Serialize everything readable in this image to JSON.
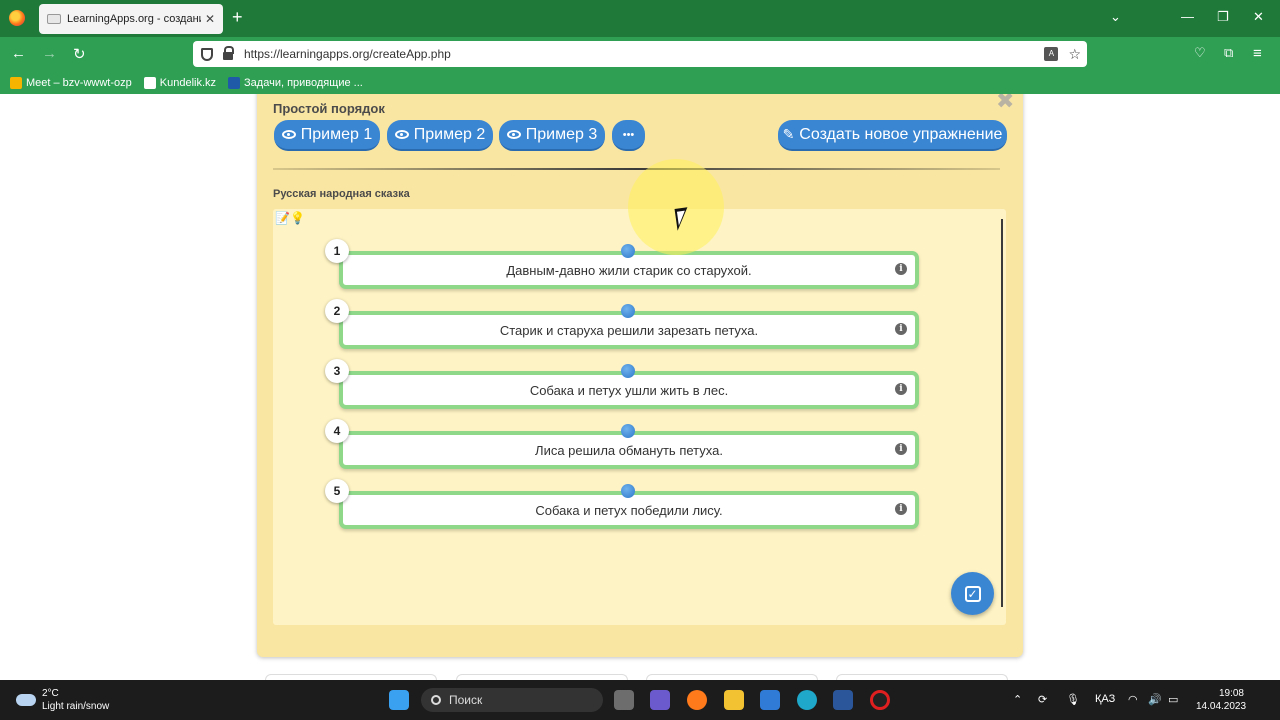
{
  "browser": {
    "tab_title": "LearningApps.org - создание м",
    "url": "https://learningapps.org/createApp.php",
    "bookmarks": [
      {
        "label": "Meet – bzv-wwwt-ozp"
      },
      {
        "label": "Kundelik.kz"
      },
      {
        "label": "Задачи, приводящие ..."
      }
    ]
  },
  "panel": {
    "title": "Простой порядок",
    "buttons": {
      "example1": "Пример 1",
      "example2": "Пример 2",
      "example3": "Пример 3",
      "more": "•••",
      "create": "Создать новое упражнение"
    },
    "story_title": "Русская народная сказка",
    "items": [
      {
        "number": "1",
        "text": "Давным-давно жили старик со старухой."
      },
      {
        "number": "2",
        "text": "Старик и старуха решили зарезать петуха."
      },
      {
        "number": "3",
        "text": "Собака и петух ушли жить в лес."
      },
      {
        "number": "4",
        "text": "Лиса решила обмануть петуха."
      },
      {
        "number": "5",
        "text": "Собака и петух победили лису."
      }
    ]
  },
  "taskbar": {
    "temperature": "2°C",
    "weather": "Light rain/snow",
    "search_placeholder": "Поиск",
    "language": "ҚАЗ",
    "time": "19:08",
    "date": "14.04.2023"
  },
  "colors": {
    "tab_bar": "#1f7a3a",
    "nav_bar": "#2f9f54",
    "panel_bg": "#fae6a3",
    "button_blue": "#3b86d3",
    "item_border": "#8fd88a"
  }
}
